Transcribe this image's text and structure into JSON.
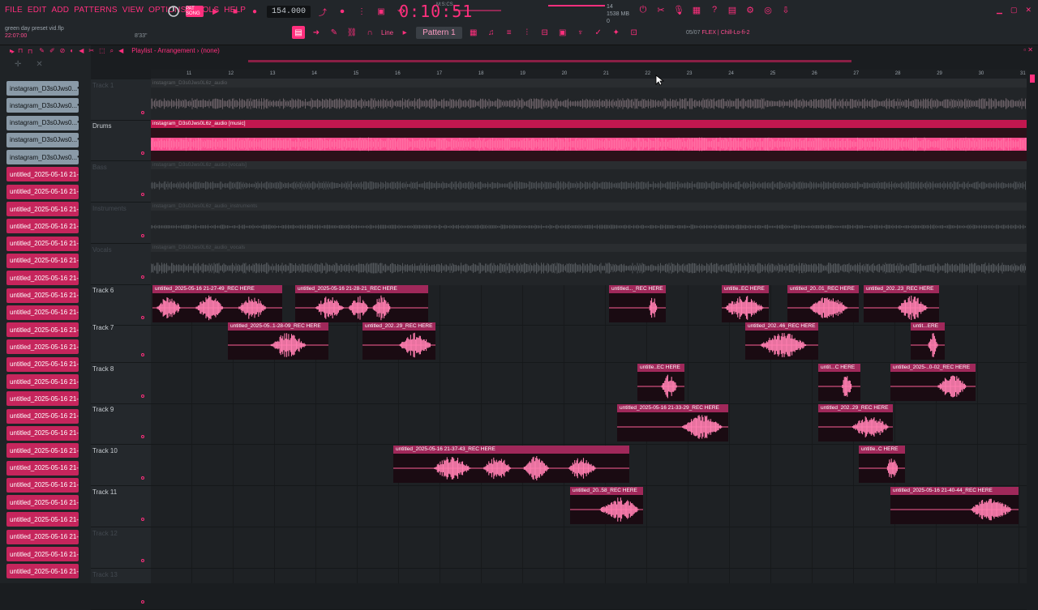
{
  "menu": [
    "FILE",
    "EDIT",
    "ADD",
    "PATTERNS",
    "VIEW",
    "OPTIONS",
    "TOOLS",
    "HELP"
  ],
  "project": {
    "name": "green day preset vid.flp",
    "time": "22:07:00",
    "size": "8'33\""
  },
  "transport": {
    "mode": "PAT SONG",
    "tempo": "154.000",
    "clock": "0:10:51",
    "clock_sub": "M:S:CS"
  },
  "cpu": {
    "memory": "1538 MB",
    "voices": "0",
    "cpu": "14"
  },
  "toolbar": {
    "snap": "Line",
    "pattern": "Pattern 1",
    "preset_prefix": "05/07",
    "preset": "FLEX | Chill-Lo-fi-2"
  },
  "playlist": {
    "title": "Playlist - Arrangement",
    "subtitle": "(none)"
  },
  "ruler": [
    "11",
    "12",
    "13",
    "14",
    "15",
    "16",
    "17",
    "18",
    "19",
    "20",
    "21",
    "22",
    "23",
    "24",
    "25",
    "26",
    "27",
    "28",
    "29",
    "30",
    "31"
  ],
  "browser_clips": [
    {
      "label": "instagram_D3s0Jws0...",
      "kind": "audio"
    },
    {
      "label": "instagram_D3s0Jws0...",
      "kind": "audio"
    },
    {
      "label": "instagram_D3s0Jws0...",
      "kind": "audio"
    },
    {
      "label": "instagram_D3s0Jws0...",
      "kind": "audio"
    },
    {
      "label": "instagram_D3s0Jws0...",
      "kind": "audio"
    },
    {
      "label": "untitled_2025-05-16 21-...",
      "kind": "pink"
    },
    {
      "label": "untitled_2025-05-16 21-...",
      "kind": "pink"
    },
    {
      "label": "untitled_2025-05-16 21-...",
      "kind": "pink"
    },
    {
      "label": "untitled_2025-05-16 21-...",
      "kind": "pink"
    },
    {
      "label": "untitled_2025-05-16 21-...",
      "kind": "pink"
    },
    {
      "label": "untitled_2025-05-16 21-...",
      "kind": "pink"
    },
    {
      "label": "untitled_2025-05-16 21-...",
      "kind": "pink"
    },
    {
      "label": "untitled_2025-05-16 21-...",
      "kind": "pink"
    },
    {
      "label": "untitled_2025-05-16 21-...",
      "kind": "pink"
    },
    {
      "label": "untitled_2025-05-16 21-...",
      "kind": "pink"
    },
    {
      "label": "untitled_2025-05-16 21-...",
      "kind": "pink"
    },
    {
      "label": "untitled_2025-05-16 21-...",
      "kind": "pink"
    },
    {
      "label": "untitled_2025-05-16 21-...",
      "kind": "pink"
    },
    {
      "label": "untitled_2025-05-16 21-...",
      "kind": "pink"
    },
    {
      "label": "untitled_2025-05-16 21-...",
      "kind": "pink"
    },
    {
      "label": "untitled_2025-05-16 21-...",
      "kind": "pink"
    },
    {
      "label": "untitled_2025-05-16 21-...",
      "kind": "pink"
    },
    {
      "label": "untitled_2025-05-16 21-...",
      "kind": "pink"
    },
    {
      "label": "untitled_2025-05-16 21-...",
      "kind": "pink"
    },
    {
      "label": "untitled_2025-05-16 21-...",
      "kind": "pink"
    },
    {
      "label": "untitled_2025-05-16 21-...",
      "kind": "pink"
    },
    {
      "label": "untitled_2025-05-16 21-...",
      "kind": "pink"
    },
    {
      "label": "untitled_2025-05-16 21-...",
      "kind": "pink"
    },
    {
      "label": "untitled_2025-05-16 21-...",
      "kind": "pink"
    }
  ],
  "tracks": [
    {
      "name": "Track 1",
      "dim": true
    },
    {
      "name": "Drums",
      "dim": false
    },
    {
      "name": "Bass",
      "dim": true
    },
    {
      "name": "Instruments",
      "dim": true
    },
    {
      "name": "Vocals",
      "dim": true
    },
    {
      "name": "Track 6",
      "dim": false
    },
    {
      "name": "Track 7",
      "dim": false
    },
    {
      "name": "Track 8",
      "dim": false
    },
    {
      "name": "Track 9",
      "dim": false
    },
    {
      "name": "Track 10",
      "dim": false
    },
    {
      "name": "Track 11",
      "dim": false
    },
    {
      "name": "Track 12",
      "dim": true
    },
    {
      "name": "Track 13",
      "dim": true
    }
  ],
  "stem_clips": [
    {
      "label": "instagram_D3s0Jws0L6z_audio"
    },
    {
      "label": "instagram_D3s0Jws0L6z_audio [music]"
    },
    {
      "label": "instagram_D3s0Jws0L6z_audio [vocals]"
    },
    {
      "label": "instagram_D3s0Jws0L6z_audio_instruments"
    },
    {
      "label": "instagram_D3s0Jws0L6z_audio_vocals"
    }
  ],
  "rec_clips": [
    {
      "label": "untitled_2025-05-16 21-27-49_REC HERE"
    },
    {
      "label": "untitled_2025-05-16 21-28-21_REC HERE"
    },
    {
      "label": "untitled..._REC HERE"
    },
    {
      "label": "untitle..EC HERE"
    },
    {
      "label": "untitled_20..01_REC HERE"
    },
    {
      "label": "untitled_202..23_REC HERE"
    },
    {
      "label": "untitled_2025-05..1-28-09_REC HERE"
    },
    {
      "label": "untitled_202..29_REC HERE"
    },
    {
      "label": "untitled_202..46_REC HERE"
    },
    {
      "label": "untit...ERE"
    },
    {
      "label": "untitle..EC HERE"
    },
    {
      "label": "untit...C HERE"
    },
    {
      "label": "untitled_2025-..0-02_REC HERE"
    },
    {
      "label": "untitled_2025-05-16 21-33-29_REC HERE"
    },
    {
      "label": "untitled_202..29_REC HERE"
    },
    {
      "label": "untitled_2025-05-16 21-37-43_REC HERE"
    },
    {
      "label": "untitle..C HERE"
    },
    {
      "label": "untitled_20..58_REC HERE"
    },
    {
      "label": "untitled_2025-05-16 21-40-44_REC HERE"
    }
  ],
  "colors": {
    "accent": "#ff2f7d",
    "clip_bar": "#a0285a",
    "drums_lane": "#ff4d8f"
  }
}
